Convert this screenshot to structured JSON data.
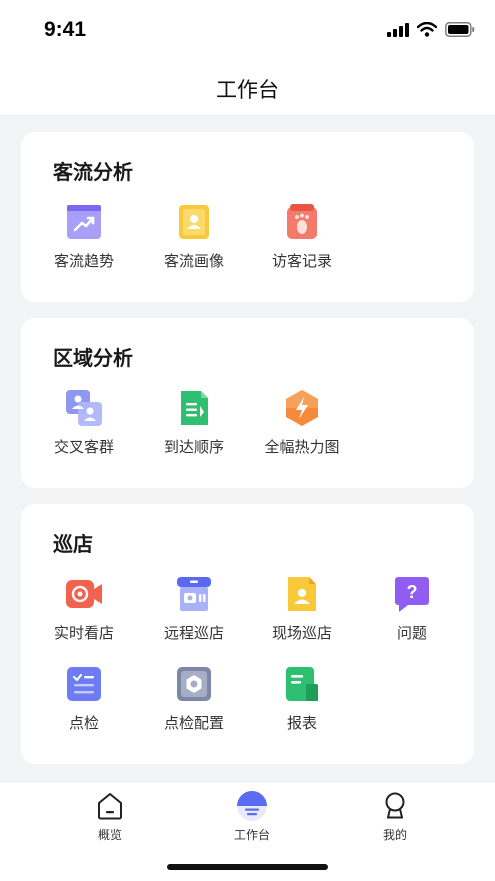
{
  "status_bar": {
    "time": "9:41"
  },
  "header": {
    "title": "工作台"
  },
  "sections": [
    {
      "title": "客流分析",
      "items": [
        {
          "label": "客流趋势",
          "icon": "trend-chart-icon",
          "color": "#8b7cf6"
        },
        {
          "label": "客流画像",
          "icon": "portrait-card-icon",
          "color": "#f9c93c"
        },
        {
          "label": "访客记录",
          "icon": "footprint-icon",
          "color": "#f26b5b"
        }
      ]
    },
    {
      "title": "区域分析",
      "items": [
        {
          "label": "交叉客群",
          "icon": "overlap-users-icon",
          "color": "#7b86f0"
        },
        {
          "label": "到达顺序",
          "icon": "document-list-icon",
          "color": "#2fbf71"
        },
        {
          "label": "全幅热力图",
          "icon": "heatmap-bolt-icon",
          "color": "#f58a3c"
        }
      ]
    },
    {
      "title": "巡店",
      "items": [
        {
          "label": "实时看店",
          "icon": "video-camera-icon",
          "color": "#f2624f"
        },
        {
          "label": "远程巡店",
          "icon": "remote-store-icon",
          "color": "#6d7cf2"
        },
        {
          "label": "现场巡店",
          "icon": "onsite-inspection-icon",
          "color": "#f9c93c"
        },
        {
          "label": "问题",
          "icon": "question-bubble-icon",
          "color": "#8f5df2"
        },
        {
          "label": "点检",
          "icon": "checklist-icon",
          "color": "#6d7cf2"
        },
        {
          "label": "点检配置",
          "icon": "inspection-config-icon",
          "color": "#7d87a8"
        },
        {
          "label": "报表",
          "icon": "report-icon",
          "color": "#2fbf71"
        }
      ]
    }
  ],
  "tabbar": [
    {
      "label": "概览",
      "icon": "home-icon",
      "active": false
    },
    {
      "label": "工作台",
      "icon": "workbench-icon",
      "active": true
    },
    {
      "label": "我的",
      "icon": "profile-icon",
      "active": false
    }
  ],
  "colors": {
    "accent": "#5b6cf0",
    "background": "#f3f4f6",
    "card": "#ffffff"
  }
}
